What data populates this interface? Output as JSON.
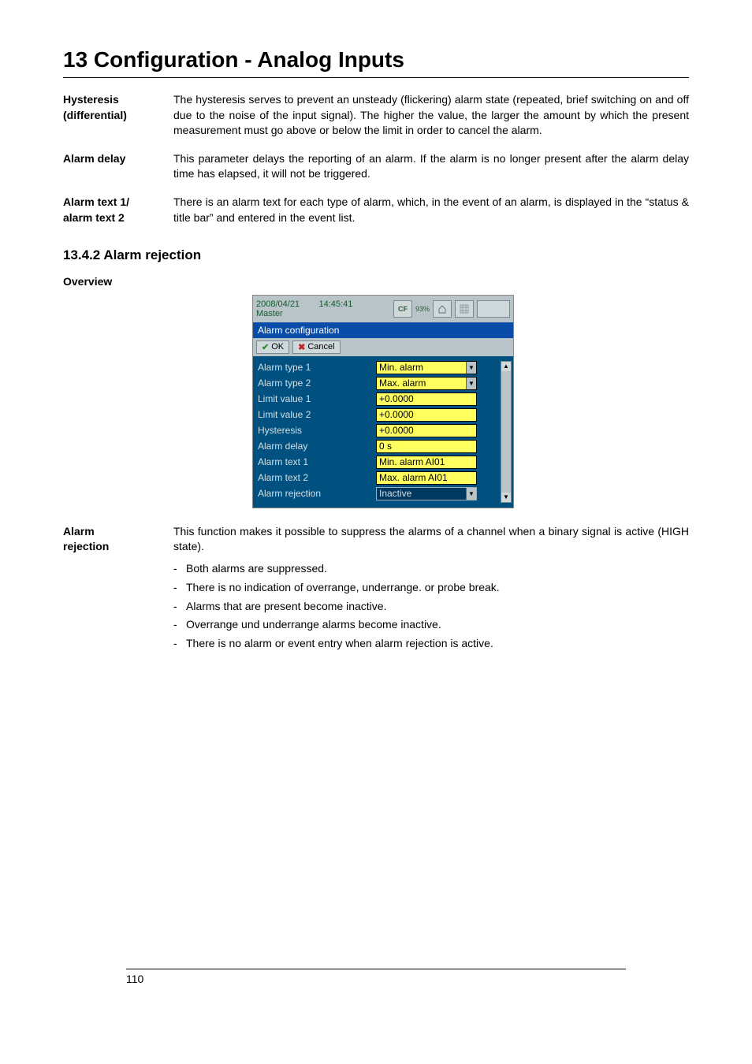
{
  "chapter": {
    "title": "13 Configuration - Analog Inputs"
  },
  "defs": {
    "hysteresis_label_l1": "Hysteresis",
    "hysteresis_label_l2": "(differential)",
    "hysteresis_text": "The hysteresis serves to prevent an unsteady (flickering) alarm state (repeated, brief switching on and off due to the noise of the input signal). The higher the value, the larger the amount by which the present measurement must go above or below the limit in order to cancel the alarm.",
    "alarm_delay_label": "Alarm delay",
    "alarm_delay_text": "This parameter delays the reporting of an alarm. If the alarm is no longer present after the alarm delay time has elapsed, it will not be triggered.",
    "alarm_text_label_l1": "Alarm text 1/",
    "alarm_text_label_l2": "alarm text 2",
    "alarm_text_text": "There is an alarm text for each type of alarm, which, in the event of an alarm, is displayed in the “status & title bar” and entered in the event list."
  },
  "section": {
    "heading": "13.4.2  Alarm rejection"
  },
  "overview_label": "Overview",
  "screenshot": {
    "status": {
      "date": "2008/04/21",
      "time": "14:45:41",
      "user": "Master",
      "cf_label": "CF",
      "pct": "93%"
    },
    "title": "Alarm configuration",
    "btn_ok": "OK",
    "btn_cancel": "Cancel",
    "rows": [
      {
        "label": "Alarm type 1",
        "value": "Min. alarm",
        "style": "yellow",
        "dropdown": true
      },
      {
        "label": "Alarm type 2",
        "value": "Max. alarm",
        "style": "yellow",
        "dropdown": true
      },
      {
        "label": "Limit value 1",
        "value": "+0.0000",
        "style": "yellow",
        "dropdown": false
      },
      {
        "label": "Limit value 2",
        "value": "+0.0000",
        "style": "yellow",
        "dropdown": false
      },
      {
        "label": "Hysteresis",
        "value": "+0.0000",
        "style": "yellow",
        "dropdown": false
      },
      {
        "label": "Alarm delay",
        "value": "0 s",
        "style": "yellow",
        "dropdown": false
      },
      {
        "label": "Alarm text 1",
        "value": "Min. alarm AI01",
        "style": "yellow",
        "dropdown": false
      },
      {
        "label": "Alarm text 2",
        "value": "Max. alarm AI01",
        "style": "yellow",
        "dropdown": false
      },
      {
        "label": "Alarm rejection",
        "value": "Inactive",
        "style": "blue",
        "dropdown": true
      }
    ]
  },
  "alarm_rejection": {
    "label_l1": "Alarm",
    "label_l2": "rejection",
    "intro": "This function makes it possible to suppress the alarms of a channel when a binary signal is active (HIGH state).",
    "bullets": [
      "Both alarms are suppressed.",
      "There is no indication of overrange, underrange. or probe break.",
      "Alarms that are present become inactive.",
      "Overrange und underrange alarms become inactive.",
      "There is no alarm or event entry when alarm rejection is active."
    ]
  },
  "page_number": "110"
}
